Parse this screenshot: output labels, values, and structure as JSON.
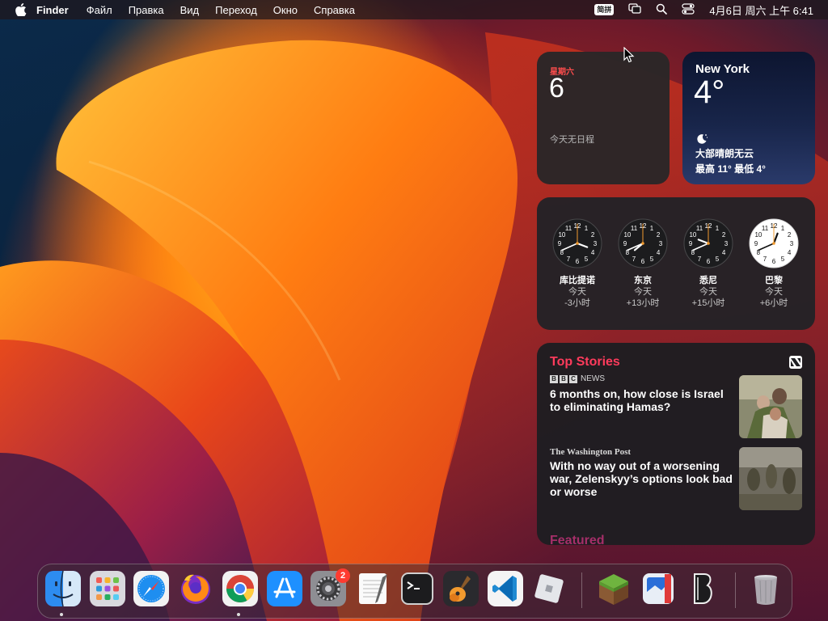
{
  "menubar": {
    "apple_icon": "apple-logo-icon",
    "app_name": "Finder",
    "menus": [
      "Файл",
      "Правка",
      "Вид",
      "Переход",
      "Окно",
      "Справка"
    ],
    "input_method": "简拼",
    "status_icons": [
      "screen-mirroring-icon",
      "spotlight-search-icon",
      "control-center-icon"
    ],
    "datetime": "4月6日 周六 上午 6:41"
  },
  "calendar_widget": {
    "weekday": "星期六",
    "day": "6",
    "events": "今天无日程"
  },
  "weather_widget": {
    "city": "New York",
    "temperature": "4°",
    "icon": "moon-icon",
    "condition": "大部晴朗无云",
    "high_low": "最高 11° 最低 4°"
  },
  "world_clock_widget": {
    "clocks": [
      {
        "city": "库比提诺",
        "day": "今天",
        "offset": "-3小时",
        "hour": 3,
        "minute": 41,
        "dark": true
      },
      {
        "city": "东京",
        "day": "今天",
        "offset": "+13小时",
        "hour": 7,
        "minute": 41,
        "dark": true
      },
      {
        "city": "悉尼",
        "day": "今天",
        "offset": "+15小时",
        "hour": 9,
        "minute": 41,
        "dark": true
      },
      {
        "city": "巴黎",
        "day": "今天",
        "offset": "+6小时",
        "hour": 12,
        "minute": 41,
        "dark": false
      }
    ]
  },
  "news_widget": {
    "header": "Top Stories",
    "icon": "apple-news-icon",
    "stories": [
      {
        "source": "NEWS",
        "source_logo": "BBC",
        "headline": "6 months on, how close is Israel to eliminating Hamas?"
      },
      {
        "source": "The Washington Post",
        "headline": "With no way out of a worsening war, Zelenskyy’s options look bad or worse"
      }
    ],
    "next_section": "Featured"
  },
  "dock": {
    "apps": [
      {
        "name": "finder-icon",
        "running": true
      },
      {
        "name": "launchpad-icon",
        "running": false
      },
      {
        "name": "safari-icon",
        "running": false
      },
      {
        "name": "firefox-icon",
        "running": false
      },
      {
        "name": "chrome-icon",
        "running": true
      },
      {
        "name": "app-store-icon",
        "running": false
      },
      {
        "name": "system-settings-icon",
        "running": false,
        "badge": "2"
      },
      {
        "name": "textedit-icon",
        "running": false
      },
      {
        "name": "terminal-icon",
        "running": false
      },
      {
        "name": "garageband-icon",
        "running": false
      },
      {
        "name": "vscode-icon",
        "running": false
      },
      {
        "name": "roblox-icon",
        "running": false
      },
      {
        "name": "minecraft-icon",
        "running": false
      },
      {
        "name": "preview-app-icon",
        "running": false
      },
      {
        "name": "bezel-app-icon",
        "running": false
      },
      {
        "name": "trash-icon",
        "running": false
      }
    ]
  },
  "colors": {
    "accent_red": "#ff3b5c",
    "calendar_red": "#ff4d4d",
    "badge_red": "#ff3b30"
  }
}
